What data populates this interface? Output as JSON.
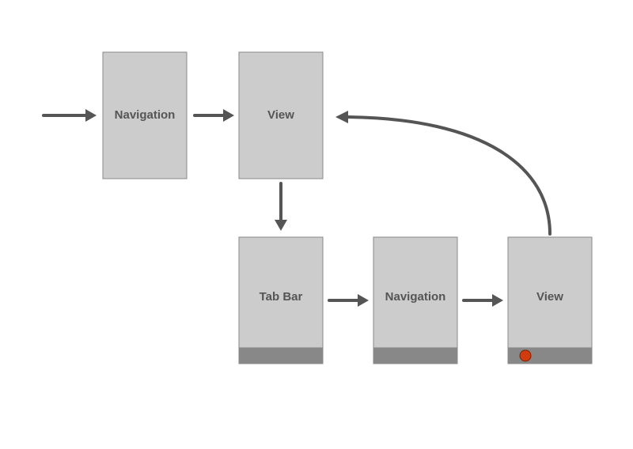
{
  "diagram": {
    "nodes": {
      "navigation_top": {
        "label": "Navigation",
        "has_tab_bar": false,
        "has_dot": false
      },
      "view_top": {
        "label": "View",
        "has_tab_bar": false,
        "has_dot": false
      },
      "tab_bar": {
        "label": "Tab Bar",
        "has_tab_bar": true,
        "has_dot": false
      },
      "navigation_bot": {
        "label": "Navigation",
        "has_tab_bar": true,
        "has_dot": false
      },
      "view_bot": {
        "label": "View",
        "has_tab_bar": true,
        "has_dot": true
      }
    },
    "edges": [
      {
        "from": "entry",
        "to": "navigation_top"
      },
      {
        "from": "navigation_top",
        "to": "view_top"
      },
      {
        "from": "view_top",
        "to": "tab_bar"
      },
      {
        "from": "tab_bar",
        "to": "navigation_bot"
      },
      {
        "from": "navigation_bot",
        "to": "view_bot"
      },
      {
        "from": "view_bot",
        "to": "view_top",
        "back_edge": true
      }
    ]
  }
}
